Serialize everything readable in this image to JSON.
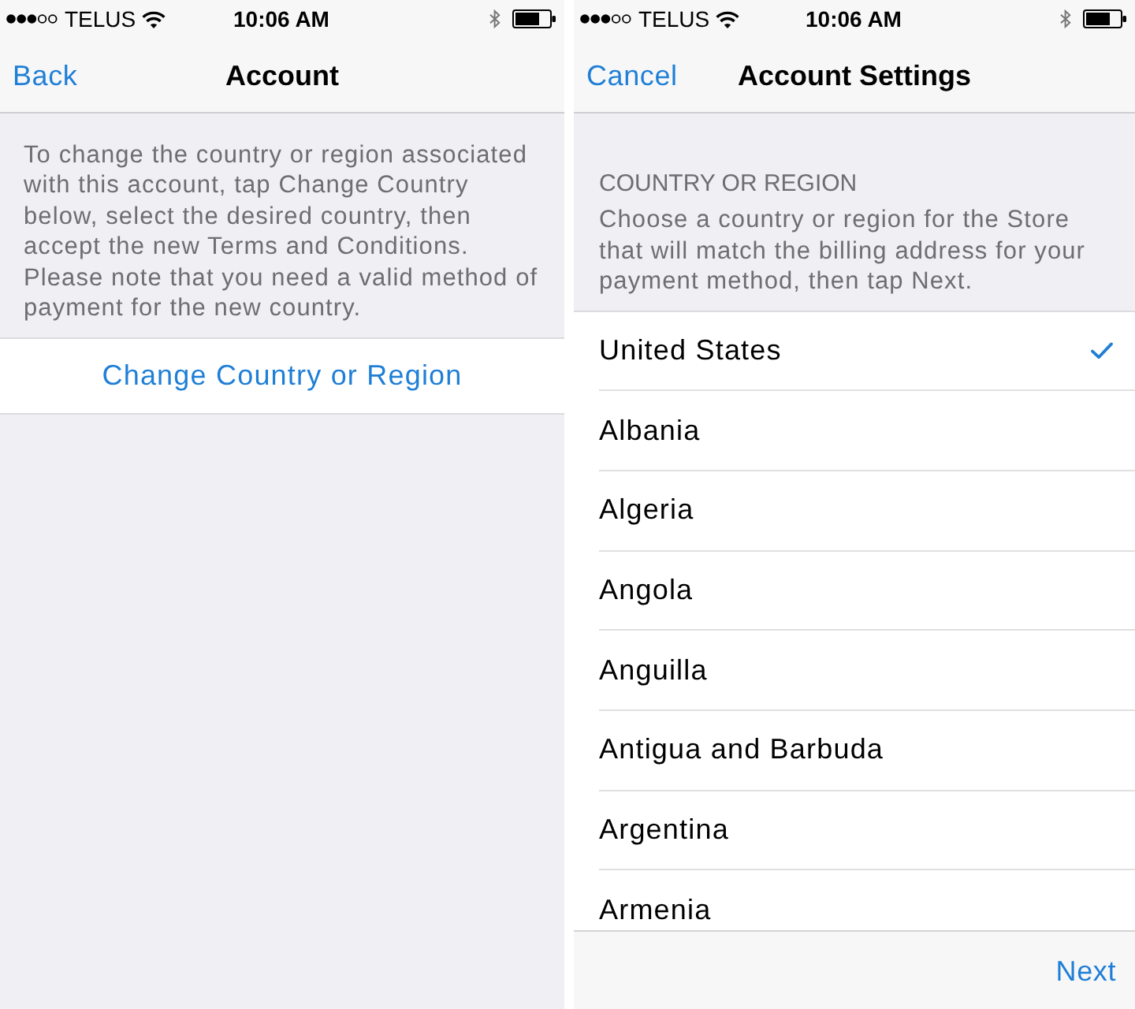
{
  "account_screen": {
    "status_bar": {
      "carrier": "TELUS",
      "time": "10:06 AM"
    },
    "nav_bar": {
      "back_button": "Back",
      "title": "Account"
    },
    "description": "To change the country or region associated with this account, tap Change Country below, select the desired country, then accept the new Terms and Conditions. Please note that you need a valid method of payment for the new country.",
    "action_button": "Change Country or Region"
  },
  "settings_screen": {
    "status_bar": {
      "carrier": "TELUS",
      "time": "10:06 AM"
    },
    "nav_bar": {
      "cancel_button": "Cancel",
      "title": "Account Settings"
    },
    "section_header": "COUNTRY OR REGION",
    "section_note": "Choose a country or region for the Store that will match the billing address for your payment method, then tap Next.",
    "countries": [
      {
        "name": "United States",
        "selected": true
      },
      {
        "name": "Albania",
        "selected": false
      },
      {
        "name": "Algeria",
        "selected": false
      },
      {
        "name": "Angola",
        "selected": false
      },
      {
        "name": "Anguilla",
        "selected": false
      },
      {
        "name": "Antigua and Barbuda",
        "selected": false
      },
      {
        "name": "Argentina",
        "selected": false
      },
      {
        "name": "Armenia",
        "selected": false
      }
    ],
    "toolbar": {
      "next_button": "Next"
    }
  }
}
